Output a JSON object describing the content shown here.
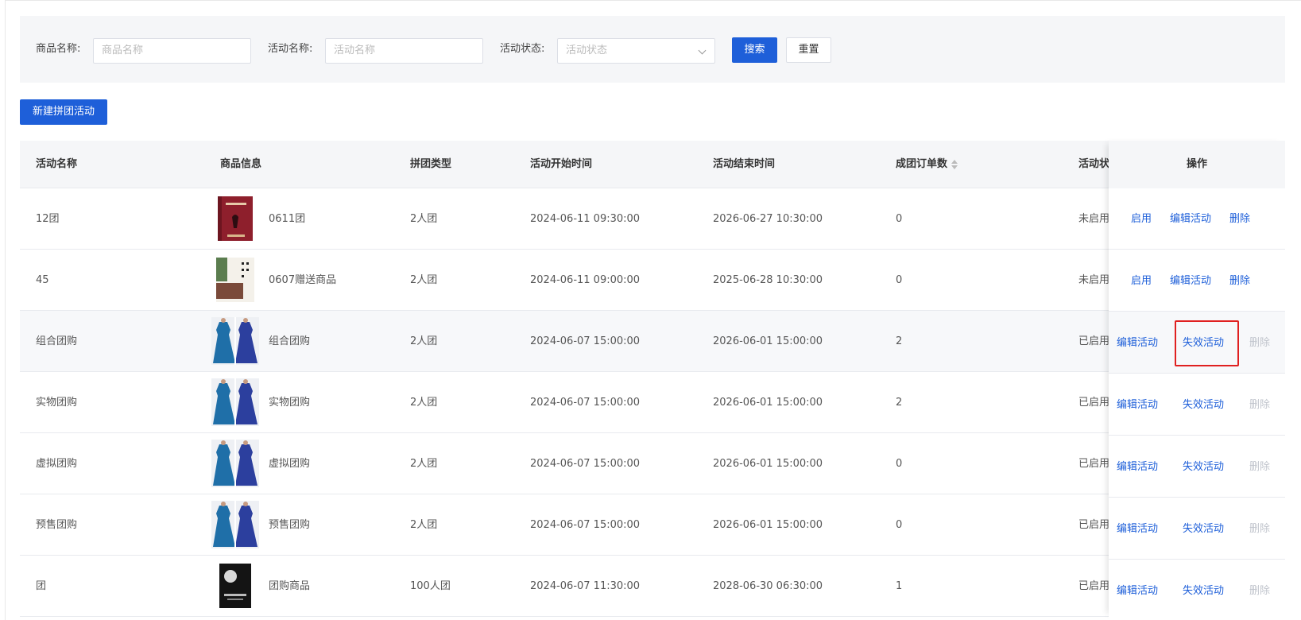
{
  "search": {
    "goods_label": "商品名称:",
    "goods_placeholder": "商品名称",
    "activity_label": "活动名称:",
    "activity_placeholder": "活动名称",
    "status_label": "活动状态:",
    "status_placeholder": "活动状态",
    "search_button": "搜索",
    "reset_button": "重置"
  },
  "new_button": "新建拼团活动",
  "table": {
    "headers": {
      "name": "活动名称",
      "goods": "商品信息",
      "type": "拼团类型",
      "start": "活动开始时间",
      "end": "活动结束时间",
      "orders": "成团订单数",
      "status": "活动状态",
      "ops": "操作"
    },
    "rows": [
      {
        "name": "12团",
        "goods": "0611团",
        "thumb": "book-red",
        "type": "2人团",
        "start": "2024-06-11 09:30:00",
        "end": "2026-06-27 10:30:00",
        "orders": "0",
        "status": "未启用",
        "op1": "启用",
        "op2": "编辑活动",
        "op3": "删除"
      },
      {
        "name": "45",
        "goods": "0607赠送商品",
        "thumb": "book-white",
        "type": "2人团",
        "start": "2024-06-11 09:00:00",
        "end": "2025-06-28 10:30:00",
        "orders": "0",
        "status": "未启用",
        "op1": "启用",
        "op2": "编辑活动",
        "op3": "删除"
      },
      {
        "name": "组合团购",
        "goods": "组合团购",
        "thumb": "dress",
        "type": "2人团",
        "start": "2024-06-07 15:00:00",
        "end": "2026-06-01 15:00:00",
        "orders": "2",
        "status": "已启用",
        "op1": "编辑活动",
        "op2": "失效活动",
        "op3": "删除"
      },
      {
        "name": "实物团购",
        "goods": "实物团购",
        "thumb": "dress",
        "type": "2人团",
        "start": "2024-06-07 15:00:00",
        "end": "2026-06-01 15:00:00",
        "orders": "2",
        "status": "已启用",
        "op1": "编辑活动",
        "op2": "失效活动",
        "op3": "删除"
      },
      {
        "name": "虚拟团购",
        "goods": "虚拟团购",
        "thumb": "dress",
        "type": "2人团",
        "start": "2024-06-07 15:00:00",
        "end": "2026-06-01 15:00:00",
        "orders": "0",
        "status": "已启用",
        "op1": "编辑活动",
        "op2": "失效活动",
        "op3": "删除"
      },
      {
        "name": "预售团购",
        "goods": "预售团购",
        "thumb": "dress",
        "type": "2人团",
        "start": "2024-06-07 15:00:00",
        "end": "2026-06-01 15:00:00",
        "orders": "0",
        "status": "已启用",
        "op1": "编辑活动",
        "op2": "失效活动",
        "op3": "删除"
      },
      {
        "name": "团",
        "goods": "团购商品",
        "thumb": "book-black",
        "type": "100人团",
        "start": "2024-06-07 11:30:00",
        "end": "2028-06-30 06:30:00",
        "orders": "1",
        "status": "已启用",
        "op1": "编辑活动",
        "op2": "失效活动",
        "op3": "删除"
      }
    ]
  },
  "colors": {
    "primary": "#1e5fd9",
    "highlight": "#e02020",
    "disabled": "#c0c4cc"
  }
}
